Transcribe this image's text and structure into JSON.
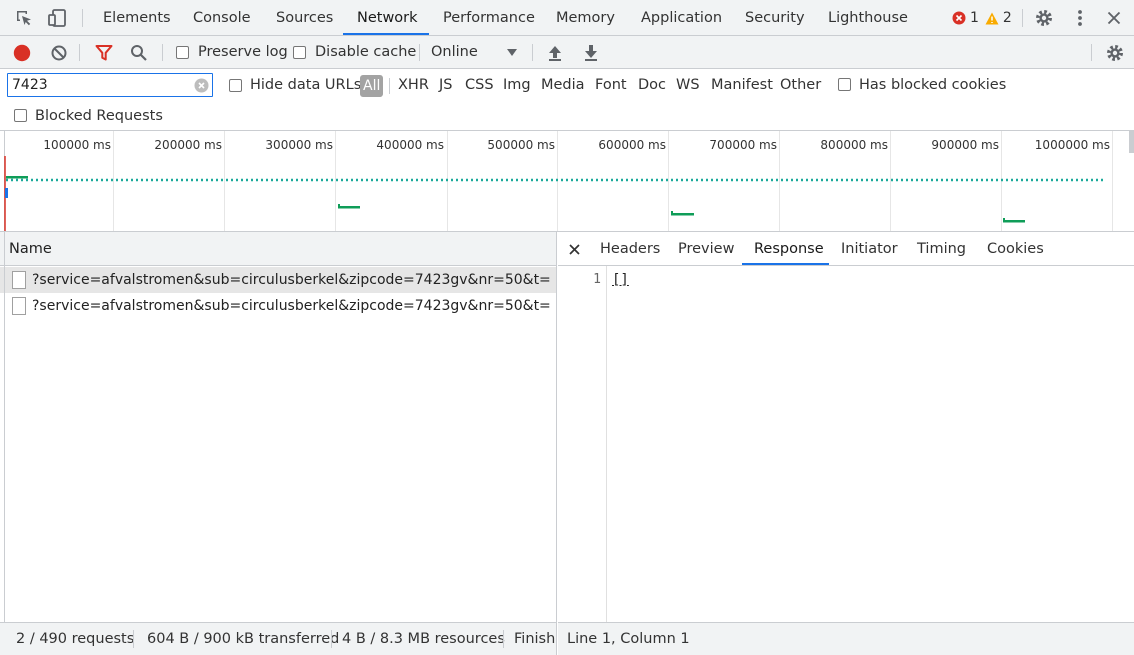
{
  "main_tabs": [
    "Elements",
    "Console",
    "Sources",
    "Network",
    "Performance",
    "Memory",
    "Application",
    "Security",
    "Lighthouse"
  ],
  "active_main_tab": "Network",
  "errors": {
    "error_count": "1",
    "warning_count": "2"
  },
  "toolbar": {
    "preserve_log": "Preserve log",
    "disable_cache": "Disable cache",
    "throttling": "Online"
  },
  "filter": {
    "value": "7423",
    "hide_data_urls": "Hide data URLs",
    "types": [
      "All",
      "XHR",
      "JS",
      "CSS",
      "Img",
      "Media",
      "Font",
      "Doc",
      "WS",
      "Manifest",
      "Other"
    ],
    "has_blocked_cookies": "Has blocked cookies",
    "blocked_requests": "Blocked Requests"
  },
  "overview": {
    "ticks": [
      "100000 ms",
      "200000 ms",
      "300000 ms",
      "400000 ms",
      "500000 ms",
      "600000 ms",
      "700000 ms",
      "800000 ms",
      "900000 ms",
      "1000000 ms"
    ]
  },
  "requests": {
    "column_name": "Name",
    "rows": [
      "?service=afvalstromen&sub=circulusberkel&zipcode=7423gv&nr=50&t=",
      "?service=afvalstromen&sub=circulusberkel&zipcode=7423gv&nr=50&t="
    ]
  },
  "detail": {
    "tabs": [
      "Headers",
      "Preview",
      "Response",
      "Initiator",
      "Timing",
      "Cookies"
    ],
    "active_tab": "Response",
    "line_number": "1",
    "response_body": "[]",
    "cursor_position": "Line 1, Column 1"
  },
  "status": {
    "requests": "2 / 490 requests",
    "transferred": "604 B / 900 kB transferred",
    "resources": "4 B / 8.3 MB resources",
    "finish": "Finish:"
  },
  "colors": {
    "accent": "#1a73e8",
    "record": "#d93025",
    "error": "#d93025",
    "warning": "#f9ab00",
    "filter_active": "#d93025"
  }
}
